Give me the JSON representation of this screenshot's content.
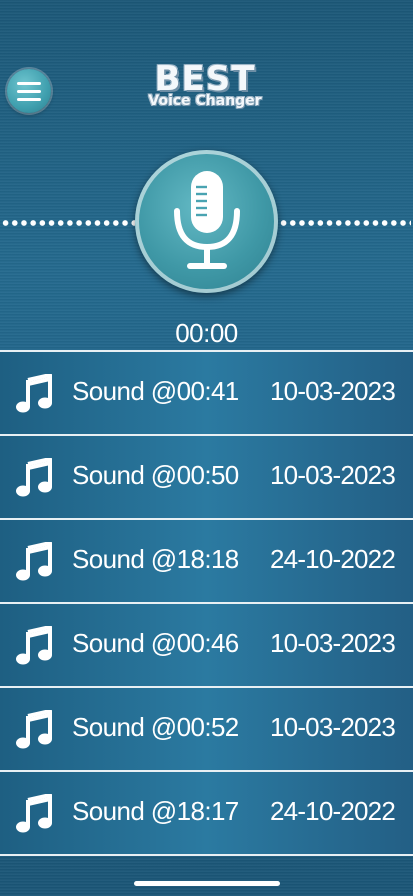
{
  "app": {
    "logo_line1": "BEST",
    "logo_line2": "Voice Changer"
  },
  "recorder": {
    "timer": "00:00"
  },
  "recordings": [
    {
      "name": "Sound @00:41",
      "date": "10-03-2023"
    },
    {
      "name": "Sound @00:50",
      "date": "10-03-2023"
    },
    {
      "name": "Sound @18:18",
      "date": "24-10-2022"
    },
    {
      "name": "Sound @00:46",
      "date": "10-03-2023"
    },
    {
      "name": "Sound @00:52",
      "date": "10-03-2023"
    },
    {
      "name": "Sound @18:17",
      "date": "24-10-2022"
    }
  ],
  "icons": {
    "menu": "hamburger-menu-icon",
    "record": "microphone-icon",
    "item": "music-note-icon"
  },
  "colors": {
    "background": "#1f6186",
    "accent": "#3f98a6",
    "text": "#ffffff"
  }
}
